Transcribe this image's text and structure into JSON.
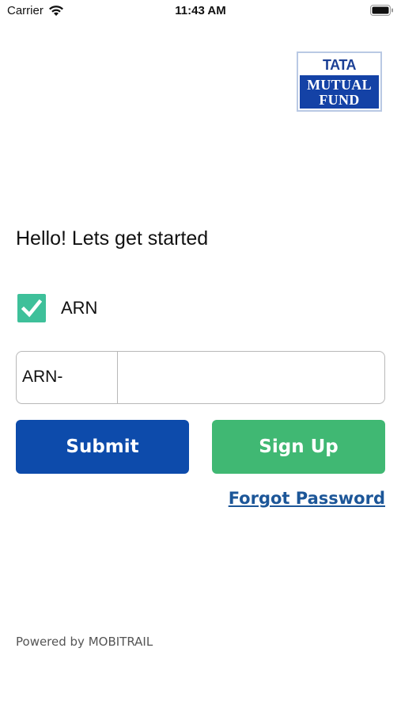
{
  "status_bar": {
    "carrier": "Carrier",
    "time": "11:43 AM",
    "icons": [
      "wifi-icon",
      "battery-icon"
    ]
  },
  "logo": {
    "line1": "TATA",
    "line2": "MUTUAL",
    "line3": "FUND",
    "colors": {
      "brand_blue": "#1442a6",
      "tata_blue": "#1b3f95"
    }
  },
  "greeting": "Hello! Lets get started",
  "arn_checkbox": {
    "label": "ARN",
    "checked": true,
    "color": "#3ec09a"
  },
  "arn_field": {
    "prefix": "ARN-",
    "value": "",
    "placeholder": ""
  },
  "buttons": {
    "submit": "Submit",
    "signup": "Sign Up",
    "submit_color": "#0d4bab",
    "signup_color": "#40b873"
  },
  "forgot_password": "Forgot Password",
  "footer": "Powered by MOBITRAIL"
}
